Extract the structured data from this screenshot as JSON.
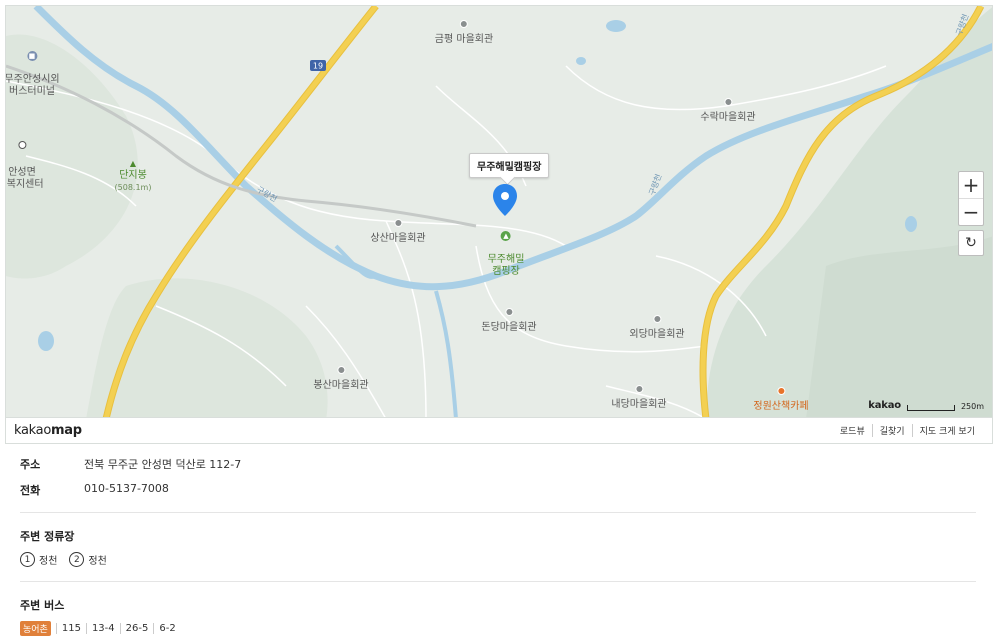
{
  "map": {
    "callout": "무주해밀캠핑장",
    "pois": [
      {
        "name": "금평 마을회관"
      },
      {
        "name": "수락마을회관"
      },
      {
        "name": "상산마을회관"
      },
      {
        "name": "돈당마을회관"
      },
      {
        "name": "외당마을회관"
      },
      {
        "name": "봉산마을회관"
      },
      {
        "name": "내당마을회관"
      },
      {
        "name": "정원산책카페"
      },
      {
        "name": "무주안성시외\n버스터미널"
      },
      {
        "name": "안성면\n1복지센터"
      },
      {
        "name": "단지봉"
      },
      {
        "name": "무주해밀\n캠핑장"
      }
    ],
    "peak_elevation": "(508.1m)",
    "road_shield": "19",
    "river_labels": [
      "구량천",
      "구량천",
      "구량천"
    ],
    "zoom_in": "+",
    "zoom_out": "−",
    "scale_brand": "kakao",
    "scale_distance": "250m"
  },
  "footer": {
    "logo_light": "kakao",
    "logo_bold": "map",
    "links": [
      "로드뷰",
      "길찾기",
      "지도 크게 보기"
    ]
  },
  "info": {
    "address_label": "주소",
    "address": "전북 무주군 안성면 덕산로 112-7",
    "phone_label": "전화",
    "phone": "010-5137-7008",
    "stops_title": "주변 정류장",
    "stops": [
      {
        "num": "1",
        "name": "정천"
      },
      {
        "num": "2",
        "name": "정천"
      }
    ],
    "bus_title": "주변 버스",
    "bus_badge": "농어촌",
    "buses": [
      "115",
      "13-4",
      "26-5",
      "6-2"
    ]
  },
  "colors": {
    "map_bg": "#e7ece7",
    "river": "#a9cfe6",
    "road_yellow": "#f3d052",
    "marker_blue": "#2b84ea",
    "badge_orange": "#e0803a"
  }
}
